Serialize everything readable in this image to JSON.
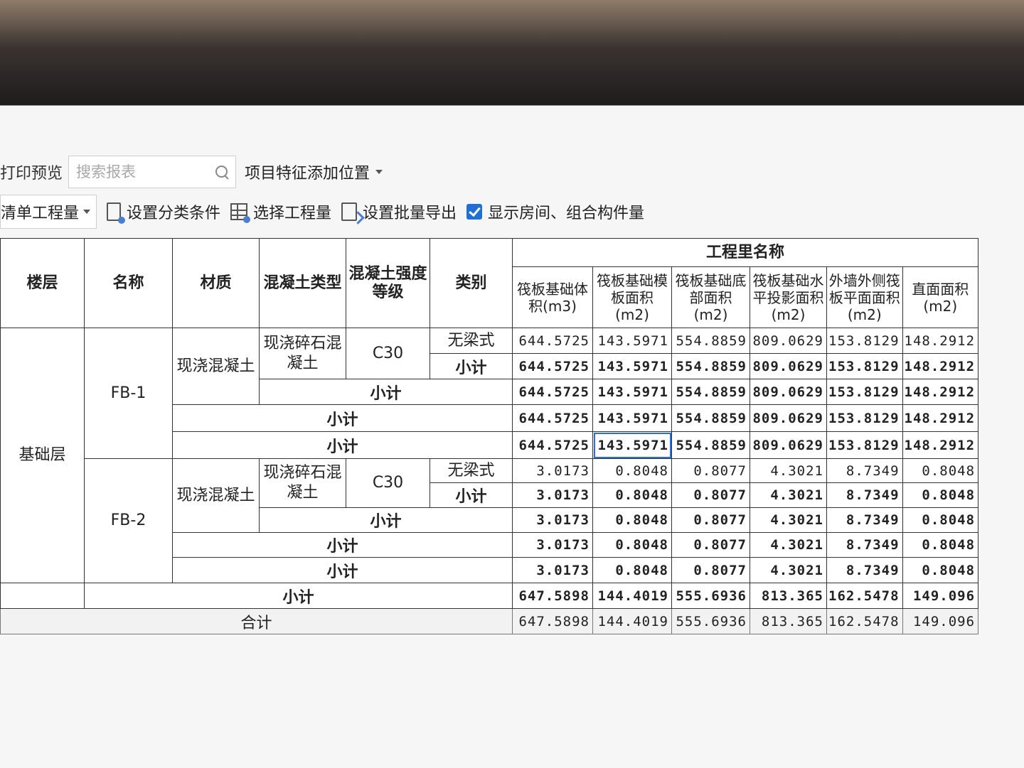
{
  "toolbar_top": {
    "print_preview": "打印预览",
    "search_placeholder": "搜索报表",
    "feature_position": "项目特征添加位置"
  },
  "toolbar": {
    "qty_type": "清单工程量",
    "set_category": "设置分类条件",
    "select_qty": "选择工程量",
    "batch_export": "设置批量导出",
    "show_rooms_label": "显示房间、组合构件量",
    "show_rooms_checked": true
  },
  "table": {
    "headers": {
      "floor": "楼层",
      "name": "名称",
      "material": "材质",
      "concrete_type": "混凝土类型",
      "concrete_grade": "混凝土强度等级",
      "category": "类别",
      "qty_group": "工程里名称",
      "qty_cols": [
        "筏板基础体积(m3)",
        "筏板基础模板面积(m2)",
        "筏板基础底部面积(m2)",
        "筏板基础水平投影面积(m2)",
        "外墙外侧筏板平面面积(m2)",
        "直面面积(m2)"
      ]
    },
    "floor_value": "基础层",
    "subtotal_label": "小计",
    "total_label": "合计",
    "groups": [
      {
        "name": "FB-1",
        "material": "现浇混凝土",
        "concrete_type": "现浇碎石混凝土",
        "grade": "C30",
        "category": "无梁式",
        "values": [
          "644.5725",
          "143.5971",
          "554.8859",
          "809.0629",
          "153.8129",
          "148.2912"
        ],
        "subtotals": [
          [
            "644.5725",
            "143.5971",
            "554.8859",
            "809.0629",
            "153.8129",
            "148.2912"
          ],
          [
            "644.5725",
            "143.5971",
            "554.8859",
            "809.0629",
            "153.8129",
            "148.2912"
          ],
          [
            "644.5725",
            "143.5971",
            "554.8859",
            "809.0629",
            "153.8129",
            "148.2912"
          ],
          [
            "644.5725",
            "143.5971",
            "554.8859",
            "809.0629",
            "153.8129",
            "148.2912"
          ]
        ]
      },
      {
        "name": "FB-2",
        "material": "现浇混凝土",
        "concrete_type": "现浇碎石混凝土",
        "grade": "C30",
        "category": "无梁式",
        "values": [
          "3.0173",
          "0.8048",
          "0.8077",
          "4.3021",
          "8.7349",
          "0.8048"
        ],
        "subtotals": [
          [
            "3.0173",
            "0.8048",
            "0.8077",
            "4.3021",
            "8.7349",
            "0.8048"
          ],
          [
            "3.0173",
            "0.8048",
            "0.8077",
            "4.3021",
            "8.7349",
            "0.8048"
          ],
          [
            "3.0173",
            "0.8048",
            "0.8077",
            "4.3021",
            "8.7349",
            "0.8048"
          ],
          [
            "3.0173",
            "0.8048",
            "0.8077",
            "4.3021",
            "8.7349",
            "0.8048"
          ]
        ]
      }
    ],
    "floor_subtotal": [
      "647.5898",
      "144.4019",
      "555.6936",
      "813.365",
      "162.5478",
      "149.096"
    ],
    "grand_total": [
      "647.5898",
      "144.4019",
      "555.6936",
      "813.365",
      "162.5478",
      "149.096"
    ]
  }
}
